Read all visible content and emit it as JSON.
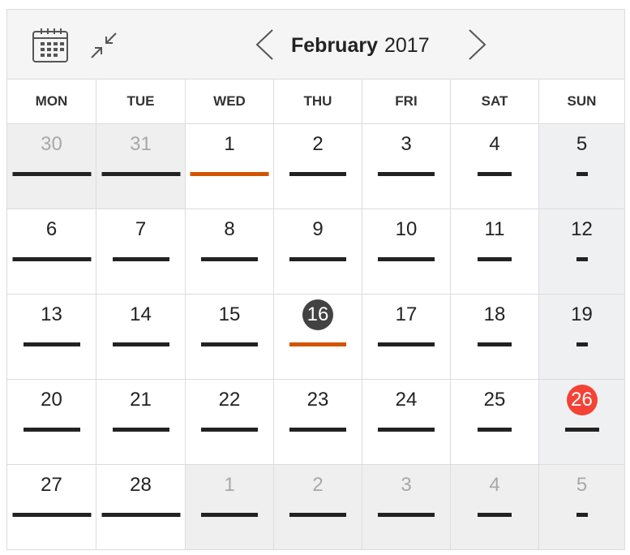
{
  "toolbar": {
    "month": "February",
    "year": "2017",
    "calendar_icon": "calendar-grid-icon",
    "collapse_icon": "collapse-arrows-icon",
    "prev_icon": "chevron-left-icon",
    "next_icon": "chevron-right-icon"
  },
  "weekdays": [
    "MON",
    "TUE",
    "WED",
    "THU",
    "FRI",
    "SAT",
    "SUN"
  ],
  "colors": {
    "accent_bar": "#d35400",
    "today_circle": "#424242",
    "holiday_circle": "#f44336",
    "default_bar": "#222222"
  },
  "weeks": [
    [
      {
        "day": "30",
        "other": true,
        "bar": "long"
      },
      {
        "day": "31",
        "other": true,
        "bar": "long"
      },
      {
        "day": "1",
        "bar": "long",
        "accent": true
      },
      {
        "day": "2",
        "bar": "medium"
      },
      {
        "day": "3",
        "bar": "medium"
      },
      {
        "day": "4",
        "bar": "short"
      },
      {
        "day": "5",
        "weekend": true,
        "bar": "tiny"
      }
    ],
    [
      {
        "day": "6",
        "bar": "long"
      },
      {
        "day": "7",
        "bar": "medium"
      },
      {
        "day": "8",
        "bar": "medium"
      },
      {
        "day": "9",
        "bar": "medium"
      },
      {
        "day": "10",
        "bar": "medium"
      },
      {
        "day": "11",
        "bar": "short"
      },
      {
        "day": "12",
        "weekend": true,
        "bar": "tiny"
      }
    ],
    [
      {
        "day": "13",
        "bar": "medium"
      },
      {
        "day": "14",
        "bar": "medium"
      },
      {
        "day": "15",
        "bar": "medium"
      },
      {
        "day": "16",
        "bar": "medium",
        "accent": true,
        "today": true
      },
      {
        "day": "17",
        "bar": "medium"
      },
      {
        "day": "18",
        "bar": "short"
      },
      {
        "day": "19",
        "weekend": true,
        "bar": "tiny"
      }
    ],
    [
      {
        "day": "20",
        "bar": "medium"
      },
      {
        "day": "21",
        "bar": "medium"
      },
      {
        "day": "22",
        "bar": "medium"
      },
      {
        "day": "23",
        "bar": "medium"
      },
      {
        "day": "24",
        "bar": "medium"
      },
      {
        "day": "25",
        "bar": "short"
      },
      {
        "day": "26",
        "weekend": true,
        "bar": "short",
        "holiday": true
      }
    ],
    [
      {
        "day": "27",
        "bar": "long"
      },
      {
        "day": "28",
        "bar": "long"
      },
      {
        "day": "1",
        "other": true,
        "bar": "medium"
      },
      {
        "day": "2",
        "other": true,
        "bar": "medium"
      },
      {
        "day": "3",
        "other": true,
        "bar": "medium"
      },
      {
        "day": "4",
        "other": true,
        "bar": "short"
      },
      {
        "day": "5",
        "other": true,
        "weekend": true,
        "bar": "tiny"
      }
    ]
  ]
}
